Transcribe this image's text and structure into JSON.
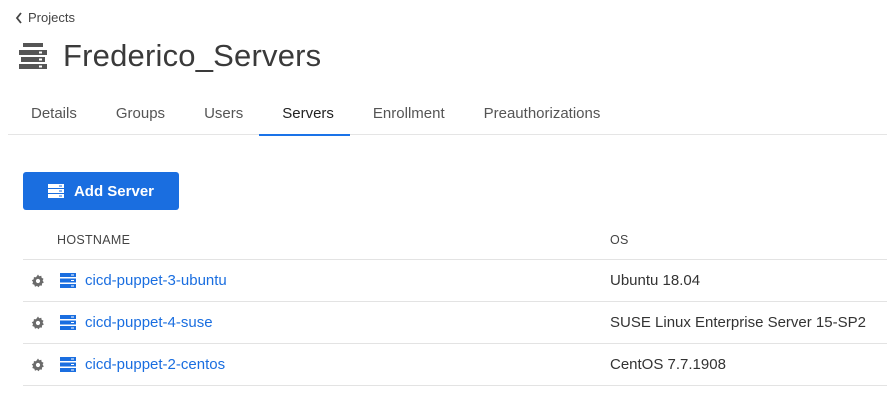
{
  "nav": {
    "back_label": "Projects"
  },
  "header": {
    "title": "Frederico_Servers"
  },
  "tabs": [
    {
      "label": "Details",
      "active": false
    },
    {
      "label": "Groups",
      "active": false
    },
    {
      "label": "Users",
      "active": false
    },
    {
      "label": "Servers",
      "active": true
    },
    {
      "label": "Enrollment",
      "active": false
    },
    {
      "label": "Preauthorizations",
      "active": false
    }
  ],
  "toolbar": {
    "add_server_label": "Add Server"
  },
  "table": {
    "columns": {
      "hostname": "HOSTNAME",
      "os": "OS"
    },
    "rows": [
      {
        "hostname": "cicd-puppet-3-ubuntu",
        "os": "Ubuntu 18.04"
      },
      {
        "hostname": "cicd-puppet-4-suse",
        "os": "SUSE Linux Enterprise Server 15-SP2"
      },
      {
        "hostname": "cicd-puppet-2-centos",
        "os": "CentOS 7.7.1908"
      }
    ]
  },
  "colors": {
    "accent": "#1a6ee0",
    "text": "#333333",
    "border": "#e3e3e3"
  },
  "icons": [
    "chevron-left-icon",
    "server-stack-icon",
    "server-icon",
    "gear-icon"
  ]
}
